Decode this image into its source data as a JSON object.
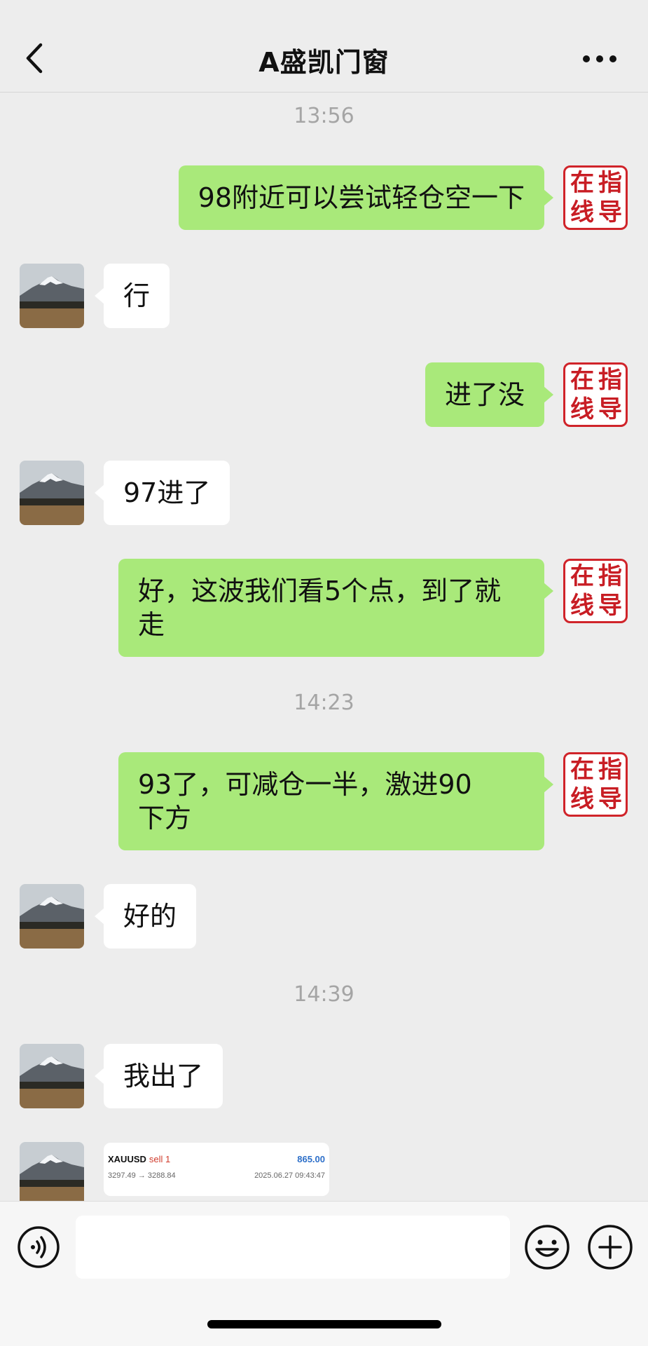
{
  "header": {
    "title": "A盛凯门窗",
    "back_icon": "chevron-left-icon",
    "more_icon": "ellipsis-icon"
  },
  "seal": {
    "chars": [
      "指",
      "导",
      "在",
      "线"
    ]
  },
  "messages": {
    "time1": "13:56",
    "m1": "98附近可以尝试轻仓空一下",
    "m2": "行",
    "m3": "进了没",
    "m4": "97进了",
    "m5_line1": "好，这波我们看5个点，到了就",
    "m5_line2": "走",
    "time2": "14:23",
    "m6_line1": "93了，可减仓一半，激进90",
    "m6_line2": "下方",
    "m7": "好的",
    "time3": "14:39",
    "m8": "我出了"
  },
  "trade_card": {
    "symbol": "XAUUSD",
    "side": "sell 1",
    "profit": "865.00",
    "prices": "3297.49 → 3288.84",
    "datetime": "2025.06.27 09:43:47"
  },
  "input_bar": {
    "placeholder": "",
    "voice_icon": "voice-icon",
    "emoji_icon": "emoji-icon",
    "plus_icon": "plus-icon"
  },
  "colors": {
    "background": "#ededed",
    "sent_bubble": "#a9e97a",
    "received_bubble": "#ffffff",
    "seal_red": "#c81d24",
    "profit_blue": "#2d6fc9",
    "sell_red": "#d03b2c"
  }
}
